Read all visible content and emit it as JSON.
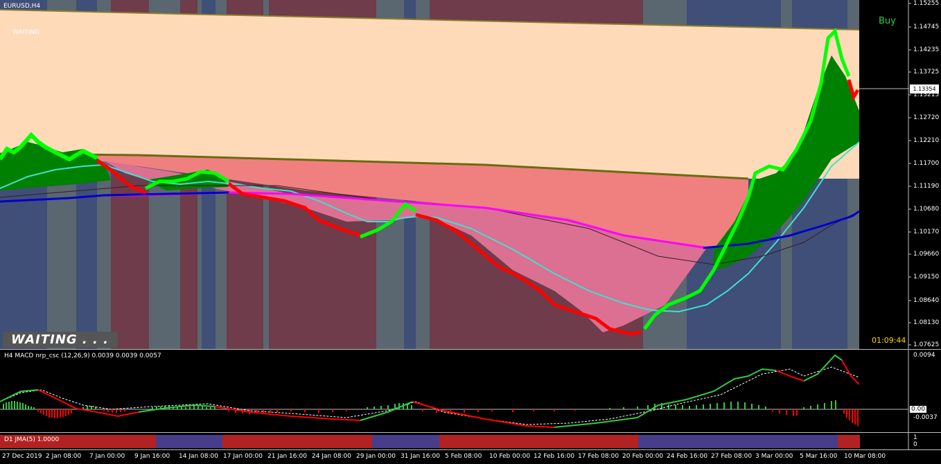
{
  "chart": {
    "symbol": "EURUSD,H4",
    "status_small": "WAITING",
    "status_big": "WAITING . . .",
    "signal": "Buy",
    "countdown": "01:09:44",
    "current_price": "1.13354",
    "price_axis": [
      "1.15255",
      "1.14745",
      "1.14235",
      "1.13725",
      "1.13215",
      "1.12720",
      "1.12210",
      "1.11700",
      "1.11190",
      "1.10680",
      "1.10170",
      "1.09660",
      "1.09150",
      "1.08640",
      "1.08130",
      "1.07625"
    ]
  },
  "macd": {
    "label": "H4 MACD nrp_csc (12,26,9) 0.0039 0.0039 0.0057",
    "axis": [
      "0.0094",
      "0.00",
      "-0.0037"
    ]
  },
  "jma": {
    "label": "D1 JMA(5) 1.0000",
    "axis": [
      "1",
      "0"
    ]
  },
  "time_axis": [
    "27 Dec 2019",
    "2 Jan 08:00",
    "7 Jan 00:00",
    "9 Jan 16:00",
    "14 Jan 08:00",
    "17 Jan 00:00",
    "21 Jan 16:00",
    "24 Jan 08:00",
    "29 Jan 00:00",
    "31 Jan 16:00",
    "5 Feb 08:00",
    "10 Feb 00:00",
    "12 Feb 16:00",
    "17 Feb 08:00",
    "20 Feb 00:00",
    "24 Feb 16:00",
    "27 Feb 08:00",
    "3 Mar 00:00",
    "5 Mar 16:00",
    "10 Mar 08:00"
  ],
  "colors": {
    "background": "#000000",
    "peach_band": "#ffdab9",
    "salmon_band": "#f08080",
    "pink_band": "#db7093",
    "bull_fill": "#008000",
    "bull_candle": "#00ff00",
    "bear_candle": "#ff0000",
    "ma_cyan": "#40e0d0",
    "ma_blue": "#0000cd",
    "ma_magenta": "#ff00ff",
    "bg_slate": "#3f4f77",
    "bg_gray": "#5a6670",
    "bg_maroon": "#6e3c4a",
    "jma_red": "#b22222",
    "jma_blue": "#483d8b",
    "countdown": "#ffd700",
    "signal": "#2ecc40"
  }
}
